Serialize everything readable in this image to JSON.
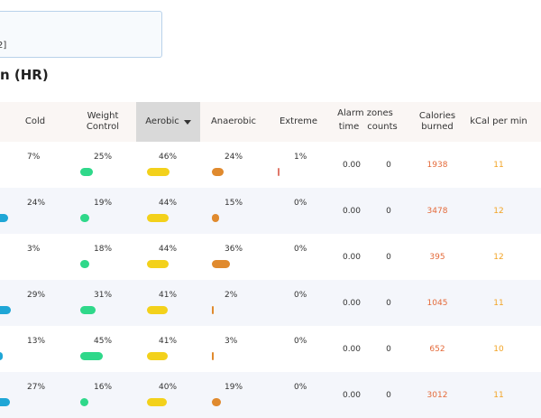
{
  "top_field": {
    "value": "2]"
  },
  "section_title": "n (HR)",
  "colors": {
    "cold": "#1fa6d6",
    "weight_control": "#2fd88a",
    "aerobic": "#f3d11b",
    "anaerobic": "#e08a2e",
    "extreme": "#e0786a",
    "header_bg": "#faf6f4",
    "alt_row_bg": "#f4f6fb",
    "calories": "#e46a3a",
    "kcal": "#f2a324"
  },
  "table": {
    "headers": {
      "cold": "Cold",
      "weight_control": "Weight Control",
      "aerobic": "Aerobic",
      "anaerobic": "Anaerobic",
      "extreme": "Extreme",
      "alarm_zones": "Alarm zones",
      "alarm_time": "time",
      "alarm_counts": "counts",
      "calories": "Calories burned",
      "kcal": "kCal per min"
    },
    "rows": [
      {
        "cold": "7%",
        "cold_v": 7,
        "wc": "25%",
        "wc_v": 25,
        "aer": "46%",
        "aer_v": 46,
        "ana": "24%",
        "ana_v": 24,
        "ext": "1%",
        "ext_v": 1,
        "time": "0.00",
        "counts": "0",
        "cal": "1938",
        "kcal": "11"
      },
      {
        "cold": "24%",
        "cold_v": 24,
        "wc": "19%",
        "wc_v": 19,
        "aer": "44%",
        "aer_v": 44,
        "ana": "15%",
        "ana_v": 15,
        "ext": "0%",
        "ext_v": 0,
        "time": "0.00",
        "counts": "0",
        "cal": "3478",
        "kcal": "12"
      },
      {
        "cold": "3%",
        "cold_v": 3,
        "wc": "18%",
        "wc_v": 18,
        "aer": "44%",
        "aer_v": 44,
        "ana": "36%",
        "ana_v": 36,
        "ext": "0%",
        "ext_v": 0,
        "time": "0.00",
        "counts": "0",
        "cal": "395",
        "kcal": "12"
      },
      {
        "cold": "29%",
        "cold_v": 29,
        "wc": "31%",
        "wc_v": 31,
        "aer": "41%",
        "aer_v": 41,
        "ana": "2%",
        "ana_v": 2,
        "ext": "0%",
        "ext_v": 0,
        "time": "0.00",
        "counts": "0",
        "cal": "1045",
        "kcal": "11"
      },
      {
        "cold": "13%",
        "cold_v": 13,
        "wc": "45%",
        "wc_v": 45,
        "aer": "41%",
        "aer_v": 41,
        "ana": "3%",
        "ana_v": 3,
        "ext": "0%",
        "ext_v": 0,
        "time": "0.00",
        "counts": "0",
        "cal": "652",
        "kcal": "10"
      },
      {
        "cold": "27%",
        "cold_v": 27,
        "wc": "16%",
        "wc_v": 16,
        "aer": "40%",
        "aer_v": 40,
        "ana": "19%",
        "ana_v": 19,
        "ext": "0%",
        "ext_v": 0,
        "time": "0.00",
        "counts": "0",
        "cal": "3012",
        "kcal": "11"
      }
    ]
  }
}
